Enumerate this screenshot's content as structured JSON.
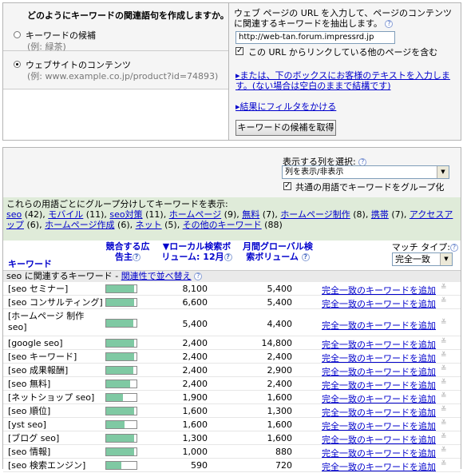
{
  "left_panel": {
    "heading": "どのようにキーワードの関連語句を作成しますか。",
    "option1_label": "キーワードの候補",
    "option1_hint": "(例: 緑茶)",
    "option2_label": "ウェブサイトのコンテンツ",
    "option2_hint": "(例: www.example.co.jp/product?id=74893)"
  },
  "right_panel": {
    "instruction": "ウェブ ページの URL を入力して、ページのコンテンツに関連するキーワードを抽出します。",
    "url_value": "http://web-tan.forum.impressrd.jp",
    "include_links_label": "この URL からリンクしている他のページを含む",
    "include_links_checked": true,
    "alt_input_link": "▸または、下のボックスにお客様のテキストを入力します。(ない場合は空白のままで結構です)",
    "filter_link": "▸結果にフィルタをかける",
    "submit_button": "キーワードの候補を取得"
  },
  "results": {
    "columns_select_label": "表示する列を選択:",
    "columns_select_value": "列を表示/非表示",
    "group_common_label": "共通の用語でキーワードをグループ化",
    "group_common_checked": true,
    "group_intro": "これらの用語ごとにグループ分けしてキーワードを表示:",
    "groups": [
      {
        "term": "seo",
        "count": " (42), "
      },
      {
        "term": "モバイル",
        "count": " (11), "
      },
      {
        "term": "seo対策",
        "count": " (11), "
      },
      {
        "term": "ホームページ",
        "count": " (9), "
      },
      {
        "term": "無料",
        "count": " (7), "
      },
      {
        "term": "ホームページ制作",
        "count": " (8), "
      },
      {
        "term": "携帯",
        "count": " (7), "
      },
      {
        "term": "アクセスアップ",
        "count": " (6), "
      },
      {
        "term": "ホームページ作成",
        "count": " (6), "
      },
      {
        "term": "ネット",
        "count": " (5), "
      },
      {
        "term": "その他のキーワード",
        "count": " (88)"
      }
    ],
    "col_keyword": "キーワード",
    "col_competition": "競合する広告主",
    "col_local": "▼ローカル検索ボリューム: 12月",
    "col_global": "月間グローバル検索ボリューム",
    "match_type_label": "マッチ タイプ:",
    "match_type_value": "完全一致",
    "section_prefix": "seo に関連するキーワード - ",
    "section_link": "関連性で並べ替え",
    "add_link_label": "完全一致のキーワードを追加",
    "rows": [
      {
        "keyword": "[seo セミナー]",
        "competition": 0.93,
        "local": "8,100",
        "global": "5,400"
      },
      {
        "keyword": "[seo コンサルティング]",
        "competition": 0.93,
        "local": "6,600",
        "global": "5,400"
      },
      {
        "keyword": "[ホームページ 制作 seo]",
        "competition": 0.9,
        "local": "5,400",
        "global": "4,400"
      },
      {
        "keyword": "[google seo]",
        "competition": 0.93,
        "local": "2,400",
        "global": "14,800"
      },
      {
        "keyword": "[seo キーワード]",
        "competition": 0.93,
        "local": "2,400",
        "global": "2,400"
      },
      {
        "keyword": "[seo 成果報酬]",
        "competition": 0.9,
        "local": "2,400",
        "global": "2,900"
      },
      {
        "keyword": "[seo 無料]",
        "competition": 0.8,
        "local": "2,400",
        "global": "2,400"
      },
      {
        "keyword": "[ネットショップ seo]",
        "competition": 0.55,
        "local": "1,900",
        "global": "1,600"
      },
      {
        "keyword": "[seo 順位]",
        "competition": 0.93,
        "local": "1,600",
        "global": "1,300"
      },
      {
        "keyword": "[yst seo]",
        "competition": 0.6,
        "local": "1,600",
        "global": "1,600"
      },
      {
        "keyword": "[ブログ seo]",
        "competition": 0.93,
        "local": "1,300",
        "global": "1,600"
      },
      {
        "keyword": "[seo 情報]",
        "competition": 0.93,
        "local": "1,000",
        "global": "880"
      },
      {
        "keyword": "[seo 検索エンジン]",
        "competition": 0.5,
        "local": "590",
        "global": "720"
      }
    ]
  }
}
